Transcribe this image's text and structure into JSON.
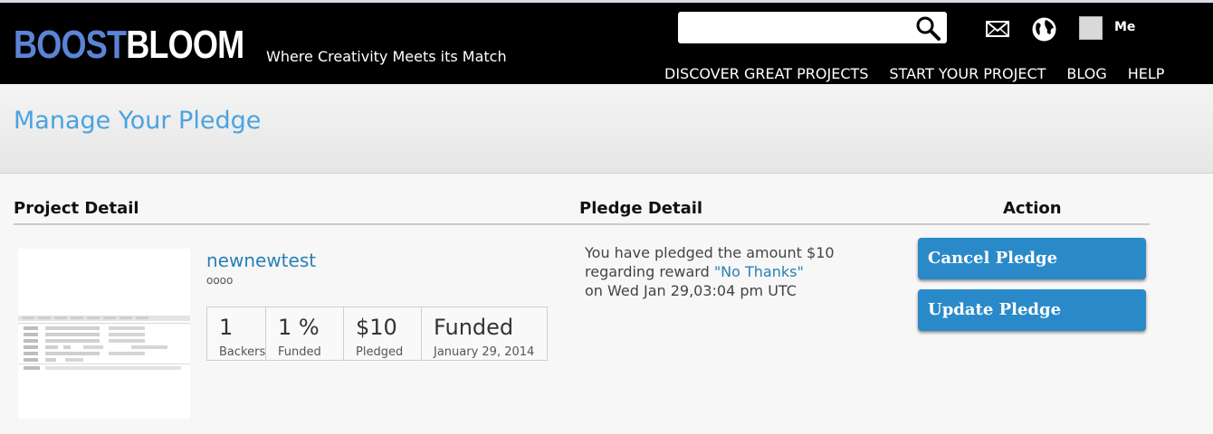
{
  "header": {
    "logo_part1": "BOOST",
    "logo_part2": "BLOOM",
    "tagline": "Where Creativity Meets its Match",
    "search_placeholder": "",
    "user_label": "Me",
    "nav": [
      "DISCOVER GREAT PROJECTS",
      "START YOUR PROJECT",
      "BLOG",
      "HELP"
    ]
  },
  "page": {
    "title": "Manage Your Pledge"
  },
  "columns": {
    "project": "Project Detail",
    "pledge": "Pledge Detail",
    "action": "Action"
  },
  "project": {
    "name": "newnewtest",
    "subtitle": "oooo",
    "stats": [
      {
        "value": "1",
        "label": "Backers"
      },
      {
        "value": "1 %",
        "label": "Funded"
      },
      {
        "value": "$10",
        "label": "Pledged"
      },
      {
        "value": "Funded",
        "label": "January 29, 2014"
      }
    ]
  },
  "pledge": {
    "line1": "You have pledged the amount $10",
    "line2_prefix": "regarding reward ",
    "reward": "\"No Thanks\"",
    "line3": "on Wed Jan 29,03:04 pm UTC"
  },
  "actions": {
    "cancel": "Cancel Pledge",
    "update": "Update Pledge"
  },
  "colors": {
    "accent": "#2a8ac9",
    "title": "#4aa3e0",
    "link": "#2a7fb5",
    "logo_boost": "#5b84d6"
  }
}
